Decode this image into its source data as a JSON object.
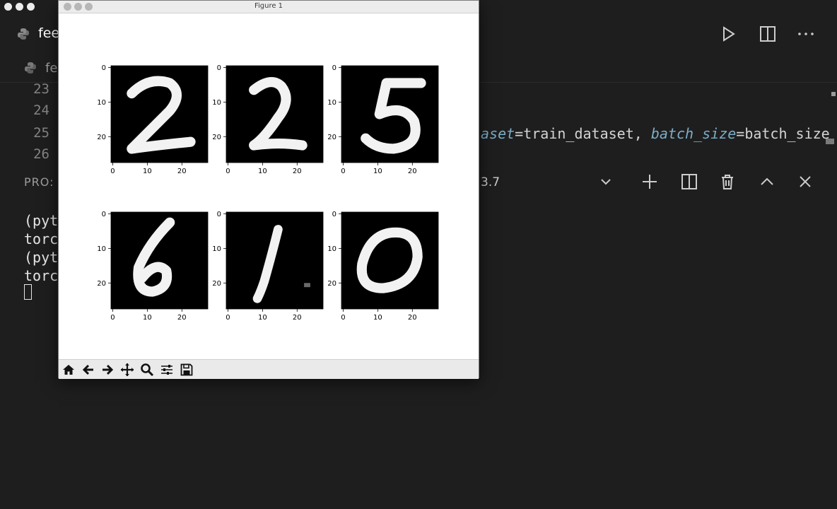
{
  "editor": {
    "tab_label": "fee",
    "breadcrumb_label": "fe",
    "line_numbers": [
      "23",
      "24",
      "25",
      "26"
    ],
    "code_line_25": {
      "p1": "aset",
      "eq1": "=",
      "v1": "train_dataset,",
      "p2": "batch_size",
      "eq2": "=",
      "v2": "batch_size"
    },
    "actions": [
      "run-icon",
      "split-editor-icon",
      "more-actions-icon"
    ]
  },
  "panel": {
    "tab_label": "PRO:",
    "extra_label": "3.7",
    "actions": [
      "chevron-down-icon",
      "plus-icon",
      "split-icon",
      "trash-icon",
      "chevron-up-icon",
      "close-icon"
    ]
  },
  "terminal": {
    "lines": [
      "(pyt",
      "torc",
      "(pyt",
      "torc"
    ]
  },
  "figure": {
    "title": "Figure 1",
    "tick_labels": [
      "0",
      "10",
      "20"
    ],
    "digits": [
      "2",
      "2",
      "5",
      "6",
      "1",
      "0"
    ],
    "toolbar": [
      "home-icon",
      "back-icon",
      "forward-icon",
      "pan-icon",
      "zoom-icon",
      "configure-icon",
      "save-icon"
    ]
  },
  "chart_data": {
    "type": "heatmap",
    "layout": "2x3 grid of grayscale 28x28 images",
    "panels": [
      {
        "digit": "2",
        "xlim": [
          0,
          27
        ],
        "ylim": [
          27,
          0
        ]
      },
      {
        "digit": "2",
        "xlim": [
          0,
          27
        ],
        "ylim": [
          27,
          0
        ]
      },
      {
        "digit": "5",
        "xlim": [
          0,
          27
        ],
        "ylim": [
          27,
          0
        ]
      },
      {
        "digit": "6",
        "xlim": [
          0,
          27
        ],
        "ylim": [
          27,
          0
        ]
      },
      {
        "digit": "1",
        "xlim": [
          0,
          27
        ],
        "ylim": [
          27,
          0
        ]
      },
      {
        "digit": "0",
        "xlim": [
          0,
          27
        ],
        "ylim": [
          27,
          0
        ]
      }
    ],
    "xticks": [
      0,
      10,
      20
    ],
    "yticks": [
      0,
      10,
      20
    ]
  }
}
